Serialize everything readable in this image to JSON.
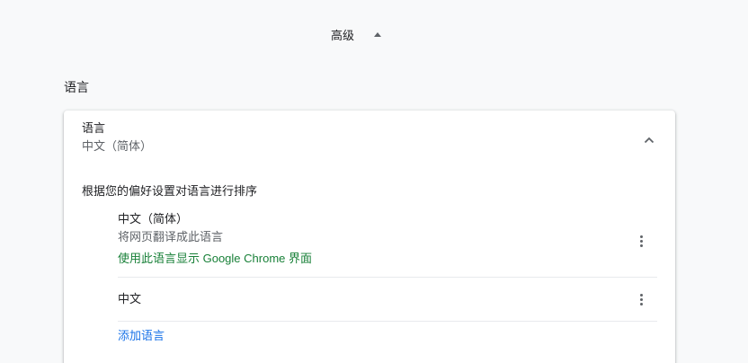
{
  "advanced": {
    "label": "高级"
  },
  "section": {
    "title": "语言"
  },
  "language_header": {
    "title": "语言",
    "value": "中文（简体）"
  },
  "order_description": "根据您的偏好设置对语言进行排序",
  "languages": [
    {
      "name": "中文（简体）",
      "subtitle": "将网页翻译成此语言",
      "ui_note": "使用此语言显示 Google Chrome 界面"
    },
    {
      "name": "中文"
    }
  ],
  "add_language_label": "添加语言",
  "colors": {
    "background": "#f8f9fa",
    "card": "#ffffff",
    "ui_note_green": "#188038",
    "link_blue": "#1a73e8",
    "secondary_text": "#5f6368"
  },
  "icons": {
    "advanced_arrow": "arrow-up-icon",
    "collapse": "chevron-up-icon",
    "more": "more-vert-icon"
  }
}
